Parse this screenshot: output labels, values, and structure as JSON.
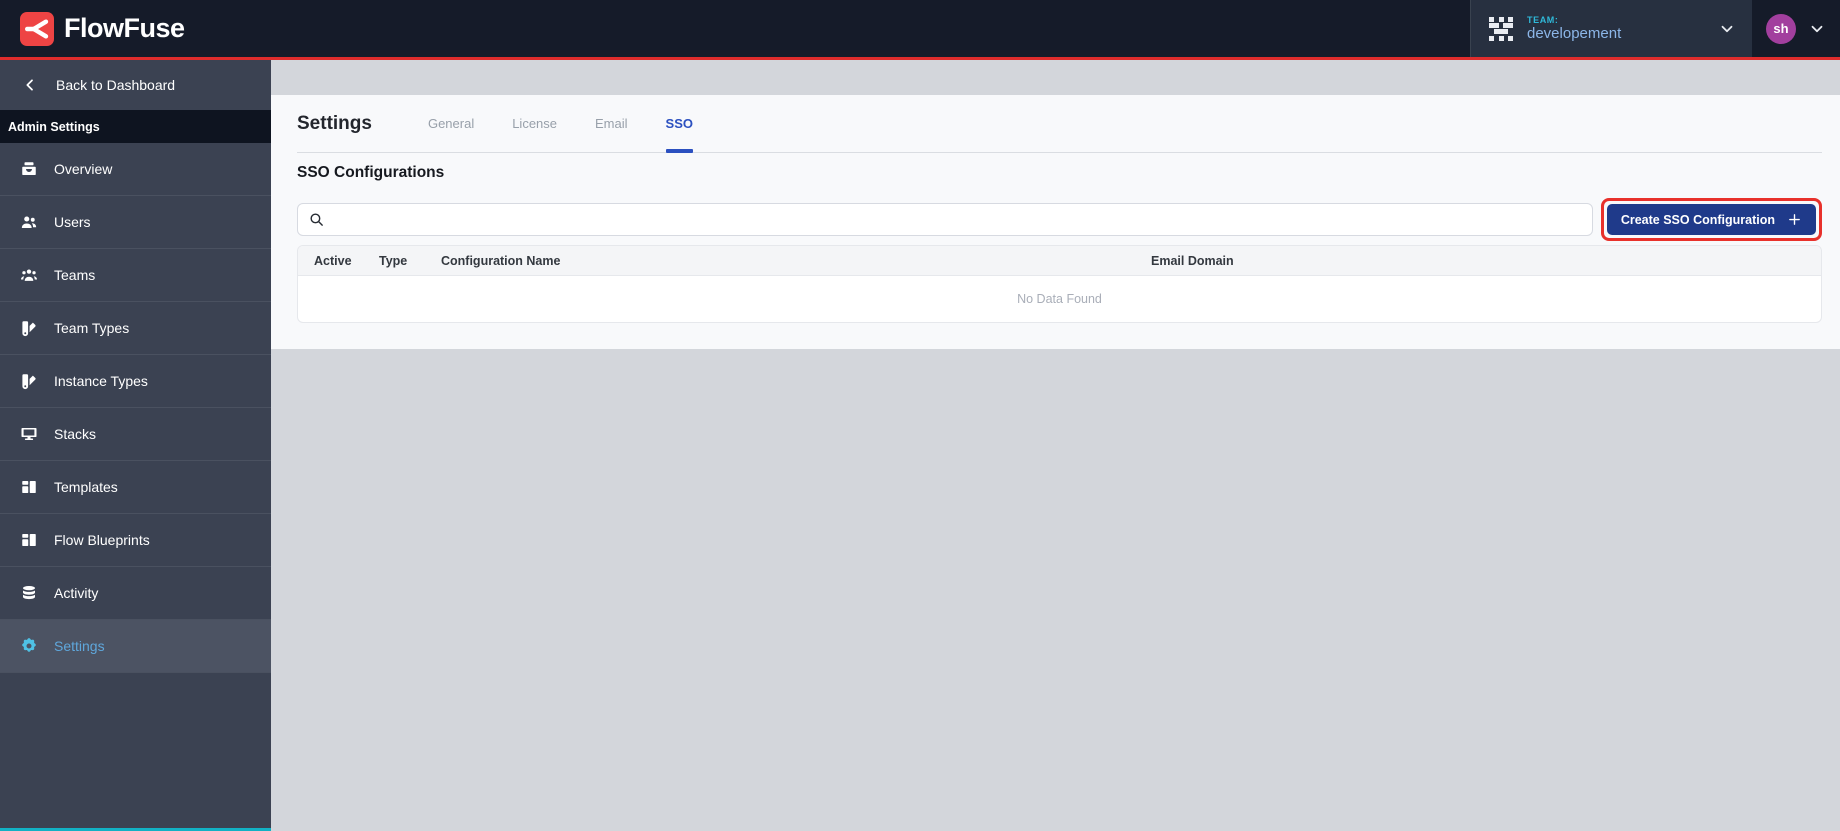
{
  "header": {
    "brand": "FlowFuse",
    "team_label": "TEAM:",
    "team_name": "developement",
    "user_initials": "sh"
  },
  "sidebar": {
    "back_label": "Back to Dashboard",
    "section_label": "Admin Settings",
    "items": [
      {
        "label": "Overview",
        "active": false
      },
      {
        "label": "Users",
        "active": false
      },
      {
        "label": "Teams",
        "active": false
      },
      {
        "label": "Team Types",
        "active": false
      },
      {
        "label": "Instance Types",
        "active": false
      },
      {
        "label": "Stacks",
        "active": false
      },
      {
        "label": "Templates",
        "active": false
      },
      {
        "label": "Flow Blueprints",
        "active": false
      },
      {
        "label": "Activity",
        "active": false
      },
      {
        "label": "Settings",
        "active": true
      }
    ]
  },
  "main": {
    "title": "Settings",
    "tabs": [
      {
        "label": "General",
        "active": false
      },
      {
        "label": "License",
        "active": false
      },
      {
        "label": "Email",
        "active": false
      },
      {
        "label": "SSO",
        "active": true
      }
    ],
    "section_title": "SSO Configurations",
    "search_value": "",
    "create_button_label": "Create SSO Configuration",
    "table": {
      "columns": [
        "Active",
        "Type",
        "Configuration Name",
        "Email Domain"
      ],
      "rows": [],
      "empty_text": "No Data Found"
    }
  },
  "colors": {
    "brand_red": "#EE4444",
    "header_red_line": "#DF2C2C",
    "highlight_box_red": "#E8312B",
    "create_button_navy": "#1F3A8A",
    "tab_active_blue": "#2B50C0",
    "sidebar_active_text": "#5FA7DC",
    "sidebar_active_icon": "#4FC1E4",
    "team_label_teal": "#2FB9D9",
    "team_name_blue": "#8CB6E8",
    "user_avatar_purple": "#A23F9E",
    "sidebar_bottom_teal": "#12B1C4"
  }
}
